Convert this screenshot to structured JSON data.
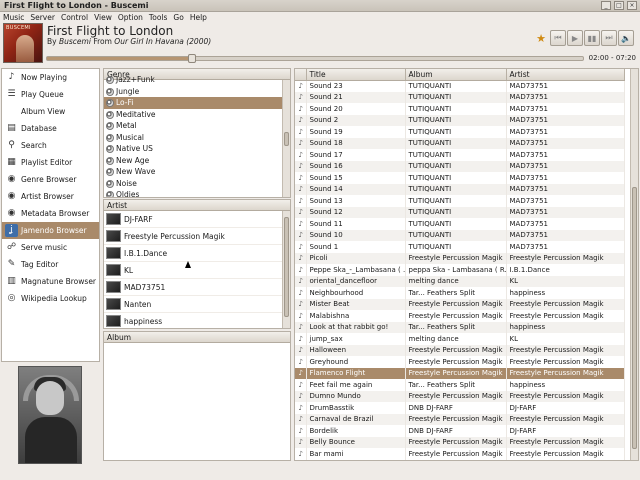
{
  "window": {
    "title": "First Flight to London - Buscemi"
  },
  "menu": [
    "Music",
    "Server",
    "Control",
    "View",
    "Option",
    "Tools",
    "Go",
    "Help"
  ],
  "now_playing": {
    "cover_label": "BUSCEMI",
    "title": "First Flight to London",
    "by": "By",
    "artist": "Buscemi",
    "from": "From",
    "album": "Our Girl In Havana (2000)",
    "elapsed": "02:00",
    "separator": "-",
    "duration": "07:20",
    "progress_fraction": 0.27
  },
  "controls": {
    "favorite_icon": "star-icon",
    "prev_icon": "previous-icon",
    "play_icon": "play-icon",
    "stop_icon": "stop-icon",
    "next_icon": "next-icon",
    "volume_icon": "speaker-icon"
  },
  "sidebar": {
    "items": [
      {
        "label": "Now Playing",
        "icon": "music-note-icon",
        "glyph": "♪"
      },
      {
        "label": "Play Queue",
        "icon": "queue-icon",
        "glyph": "☰"
      },
      {
        "label": "Album View",
        "icon": "",
        "glyph": ""
      },
      {
        "label": "Database",
        "icon": "database-icon",
        "glyph": "▤"
      },
      {
        "label": "Search",
        "icon": "search-icon",
        "glyph": "⚲"
      },
      {
        "label": "Playlist Editor",
        "icon": "playlist-icon",
        "glyph": "▦"
      },
      {
        "label": "Genre Browser",
        "icon": "genre-icon",
        "glyph": "◉"
      },
      {
        "label": "Artist Browser",
        "icon": "artist-icon",
        "glyph": "◉"
      },
      {
        "label": "Metadata Browser",
        "icon": "metadata-icon",
        "glyph": "◉"
      },
      {
        "label": "Jamendo Browser",
        "icon": "jamendo-icon",
        "glyph": "ʝ"
      },
      {
        "label": "Serve music",
        "icon": "network-icon",
        "glyph": "☍"
      },
      {
        "label": "Tag Editor",
        "icon": "tag-icon",
        "glyph": "✎"
      },
      {
        "label": "Magnatune Browser",
        "icon": "magnatune-icon",
        "glyph": "▥"
      },
      {
        "label": "Wikipedia Lookup",
        "icon": "wikipedia-icon",
        "glyph": "◎"
      }
    ],
    "selected_index": 9
  },
  "genre": {
    "header": "Genre",
    "items": [
      "Jazz+Funk",
      "Jungle",
      "Lo-Fi",
      "Meditative",
      "Metal",
      "Musical",
      "Native US",
      "New Age",
      "New Wave",
      "Noise",
      "Oldies"
    ],
    "selected": "Lo-Fi"
  },
  "artist": {
    "header": "Artist",
    "items": [
      "DJ-FARF",
      "Freestyle Percussion Magik",
      "I.B.1.Dance",
      "KL",
      "MAD73751",
      "Nanten",
      "happiness"
    ]
  },
  "album": {
    "header": "Album"
  },
  "tracks": {
    "columns": [
      "Title",
      "Album",
      "Artist"
    ],
    "selected_index": 28,
    "rows": [
      [
        "Sound 23",
        "TUTIQUANTI",
        "MAD73751"
      ],
      [
        "Sound 21",
        "TUTIQUANTI",
        "MAD73751"
      ],
      [
        "Sound 20",
        "TUTIQUANTI",
        "MAD73751"
      ],
      [
        "Sound 2",
        "TUTIQUANTI",
        "MAD73751"
      ],
      [
        "Sound 19",
        "TUTIQUANTI",
        "MAD73751"
      ],
      [
        "Sound 18",
        "TUTIQUANTI",
        "MAD73751"
      ],
      [
        "Sound 17",
        "TUTIQUANTI",
        "MAD73751"
      ],
      [
        "Sound 16",
        "TUTIQUANTI",
        "MAD73751"
      ],
      [
        "Sound 15",
        "TUTIQUANTI",
        "MAD73751"
      ],
      [
        "Sound 14",
        "TUTIQUANTI",
        "MAD73751"
      ],
      [
        "Sound 13",
        "TUTIQUANTI",
        "MAD73751"
      ],
      [
        "Sound 12",
        "TUTIQUANTI",
        "MAD73751"
      ],
      [
        "Sound 11",
        "TUTIQUANTI",
        "MAD73751"
      ],
      [
        "Sound 10",
        "TUTIQUANTI",
        "MAD73751"
      ],
      [
        "Sound 1",
        "TUTIQUANTI",
        "MAD73751"
      ],
      [
        "Picoli",
        "Freestyle Percussion Magik",
        "Freestyle Percussion Magik"
      ],
      [
        "Peppe Ska_-_Lambasana ( ...",
        "peppa Ska - Lambasana ( R...",
        "I.B.1.Dance"
      ],
      [
        "oriental_dancefloor",
        "melting dance",
        "KL"
      ],
      [
        "Neighbourhood",
        "Tar... Feathers Split",
        "happiness"
      ],
      [
        "Mister Beat",
        "Freestyle Percussion Magik",
        "Freestyle Percussion Magik"
      ],
      [
        "Malabishna",
        "Freestyle Percussion Magik",
        "Freestyle Percussion Magik"
      ],
      [
        "Look at that rabbit go!",
        "Tar... Feathers Split",
        "happiness"
      ],
      [
        "jump_sax",
        "melting dance",
        "KL"
      ],
      [
        "Halloween",
        "Freestyle Percussion Magik",
        "Freestyle Percussion Magik"
      ],
      [
        "Greyhound",
        "Freestyle Percussion Magik",
        "Freestyle Percussion Magik"
      ],
      [
        "Flamenco Flight",
        "Freestyle Percussion Magik",
        "Freestyle Percussion Magik"
      ],
      [
        "Feet fail me again",
        "Tar... Feathers Split",
        "happiness"
      ],
      [
        "Dumno Mundo",
        "Freestyle Percussion Magik",
        "Freestyle Percussion Magik"
      ],
      [
        "DrumBasstik",
        "DNB DJ-FARF",
        "DJ-FARF"
      ],
      [
        "Carnaval de Brazil",
        "Freestyle Percussion Magik",
        "Freestyle Percussion Magik"
      ],
      [
        "Bordelik",
        "DNB DJ-FARF",
        "DJ-FARF"
      ],
      [
        "Belly Bounce",
        "Freestyle Percussion Magik",
        "Freestyle Percussion Magik"
      ],
      [
        "Bar mami",
        "Freestyle Percussion Magik",
        "Freestyle Percussion Magik"
      ]
    ]
  },
  "colors": {
    "selection": "#a98a6a",
    "accent_star": "#d08a12"
  }
}
